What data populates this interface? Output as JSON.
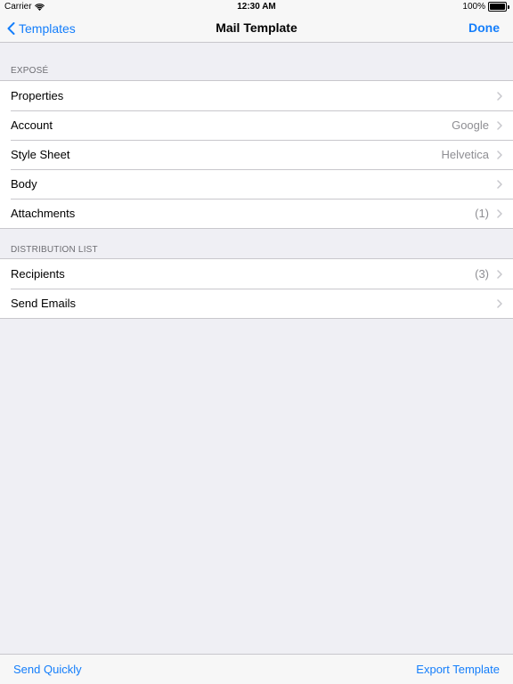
{
  "status_bar": {
    "carrier": "Carrier",
    "time": "12:30 AM",
    "battery_text": "100%",
    "battery_level": 1.0,
    "wifi_icon": "wifi-icon",
    "battery_icon": "battery-icon"
  },
  "nav": {
    "back_label": "Templates",
    "back_icon": "chevron-left-icon",
    "title": "Mail Template",
    "done_label": "Done"
  },
  "sections": [
    {
      "header": "EXPOSÉ",
      "rows": [
        {
          "label": "Properties",
          "value": ""
        },
        {
          "label": "Account",
          "value": "Google"
        },
        {
          "label": "Style Sheet",
          "value": "Helvetica"
        },
        {
          "label": "Body",
          "value": ""
        },
        {
          "label": "Attachments",
          "value": "(1)"
        }
      ]
    },
    {
      "header": "DISTRIBUTION LIST",
      "rows": [
        {
          "label": "Recipients",
          "value": "(3)"
        },
        {
          "label": "Send Emails",
          "value": ""
        }
      ]
    }
  ],
  "toolbar": {
    "left_label": "Send Quickly",
    "right_label": "Export Template"
  },
  "colors": {
    "accent": "#147efb",
    "background": "#efeff4",
    "separator": "#c8c7cc",
    "secondary_text": "#8e8e93",
    "section_header_text": "#6d6d72"
  }
}
